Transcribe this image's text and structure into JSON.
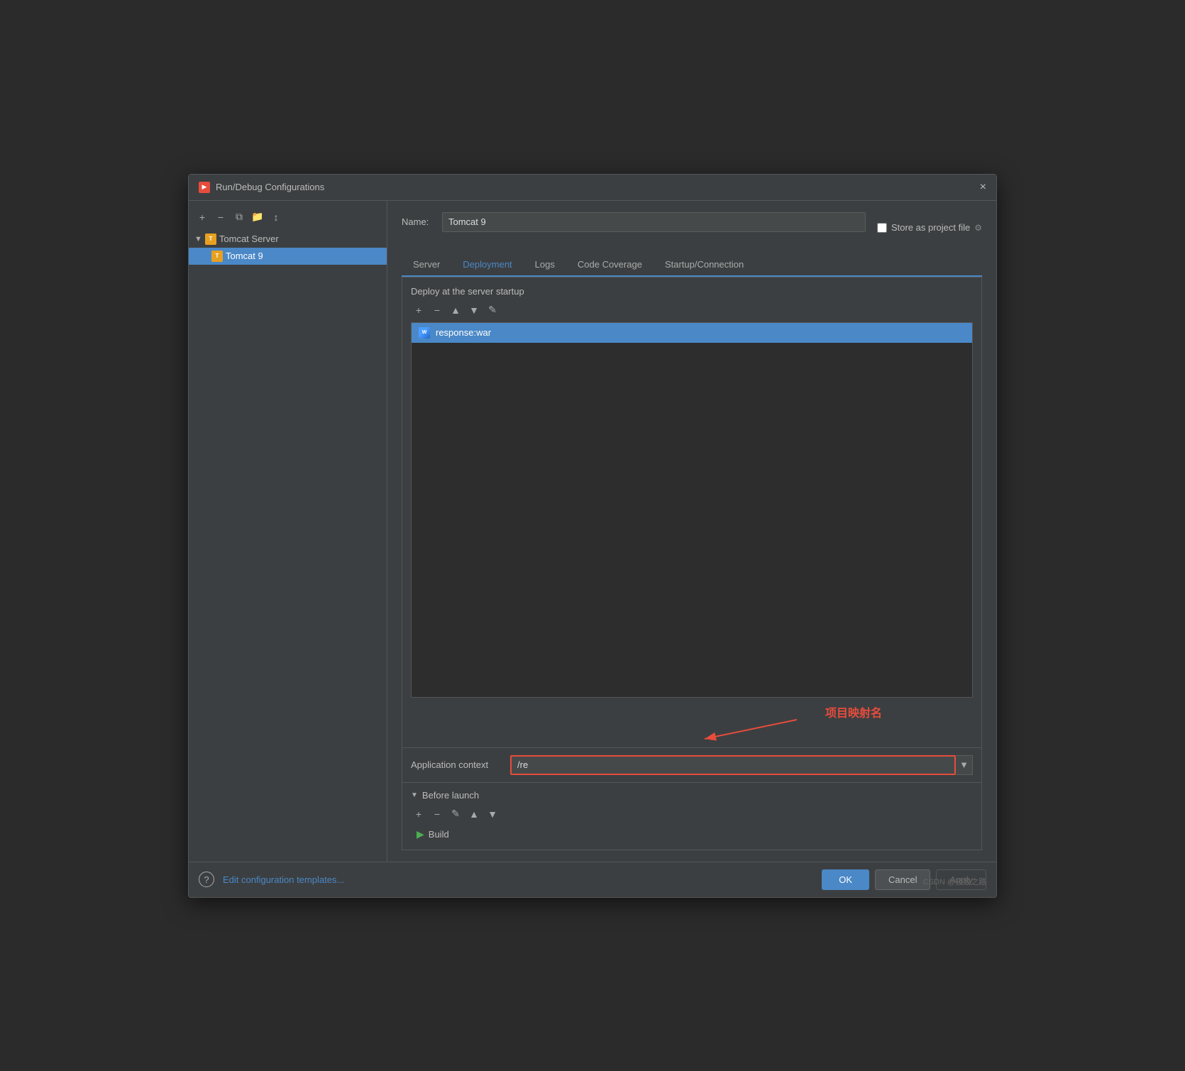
{
  "dialog": {
    "title": "Run/Debug Configurations",
    "close_label": "×"
  },
  "sidebar": {
    "toolbar": {
      "add_label": "+",
      "remove_label": "−",
      "copy_label": "⧉",
      "folder_label": "📁",
      "sort_label": "↕"
    },
    "group": {
      "label": "Tomcat Server",
      "expanded": true
    },
    "item": {
      "label": "Tomcat 9",
      "selected": true
    }
  },
  "name_row": {
    "label": "Name:",
    "value": "Tomcat 9"
  },
  "store": {
    "label": "Store as project file",
    "checked": false
  },
  "tabs": [
    {
      "label": "Server",
      "active": false
    },
    {
      "label": "Deployment",
      "active": true
    },
    {
      "label": "Logs",
      "active": false
    },
    {
      "label": "Code Coverage",
      "active": false
    },
    {
      "label": "Startup/Connection",
      "active": false
    }
  ],
  "deployment": {
    "section_label": "Deploy at the server startup",
    "toolbar": {
      "add": "+",
      "remove": "−",
      "up": "▲",
      "down": "▼",
      "edit": "✎"
    },
    "items": [
      {
        "label": "response:war",
        "icon": "war-icon"
      }
    ]
  },
  "app_context": {
    "label": "Application context",
    "value": "/re",
    "placeholder": ""
  },
  "annotation": {
    "label": "项目映射名"
  },
  "before_launch": {
    "label": "Before launch",
    "toolbar": {
      "add": "+",
      "remove": "−",
      "edit": "✎",
      "up": "▲",
      "down": "▼"
    },
    "items": [
      {
        "label": "Build",
        "icon": "build-icon"
      }
    ]
  },
  "bottom": {
    "help_label": "?",
    "edit_templates_label": "Edit configuration templates...",
    "ok_label": "OK",
    "cancel_label": "Cancel",
    "apply_label": "Apply"
  },
  "watermark": "CSDN @极致之路"
}
